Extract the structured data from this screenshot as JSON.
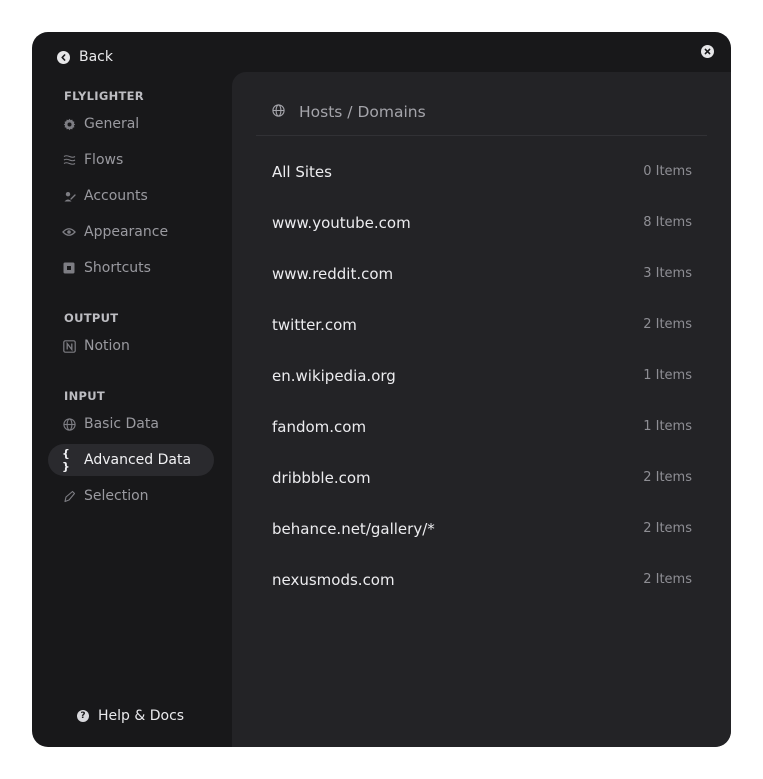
{
  "header": {
    "back_label": "Back"
  },
  "sidebar": {
    "sections": [
      {
        "title": "FLYLIGHTER",
        "items": [
          {
            "label": "General",
            "icon": "gear-icon"
          },
          {
            "label": "Flows",
            "icon": "waves-icon"
          },
          {
            "label": "Accounts",
            "icon": "key-icon"
          },
          {
            "label": "Appearance",
            "icon": "eye-icon"
          },
          {
            "label": "Shortcuts",
            "icon": "keyboard-icon"
          }
        ]
      },
      {
        "title": "OUTPUT",
        "items": [
          {
            "label": "Notion",
            "icon": "notion-icon"
          }
        ]
      },
      {
        "title": "INPUT",
        "items": [
          {
            "label": "Basic Data",
            "icon": "globe-icon"
          },
          {
            "label": "Advanced Data",
            "icon": "braces-icon",
            "active": true
          },
          {
            "label": "Selection",
            "icon": "pen-icon"
          }
        ]
      }
    ],
    "help_label": "Help & Docs"
  },
  "main": {
    "title": "Hosts / Domains",
    "hosts": [
      {
        "host": "All Sites",
        "count": "0 Items"
      },
      {
        "host": "www.youtube.com",
        "count": "8 Items"
      },
      {
        "host": "www.reddit.com",
        "count": "3 Items"
      },
      {
        "host": "twitter.com",
        "count": "2 Items"
      },
      {
        "host": "en.wikipedia.org",
        "count": "1 Items"
      },
      {
        "host": "fandom.com",
        "count": "1 Items"
      },
      {
        "host": "dribbble.com",
        "count": "2 Items"
      },
      {
        "host": "behance.net/gallery/*",
        "count": "2 Items"
      },
      {
        "host": "nexusmods.com",
        "count": "2 Items"
      }
    ]
  },
  "colors": {
    "window_bg": "#18181a",
    "panel_bg": "#232326",
    "active_bg": "#2a2a2e"
  }
}
